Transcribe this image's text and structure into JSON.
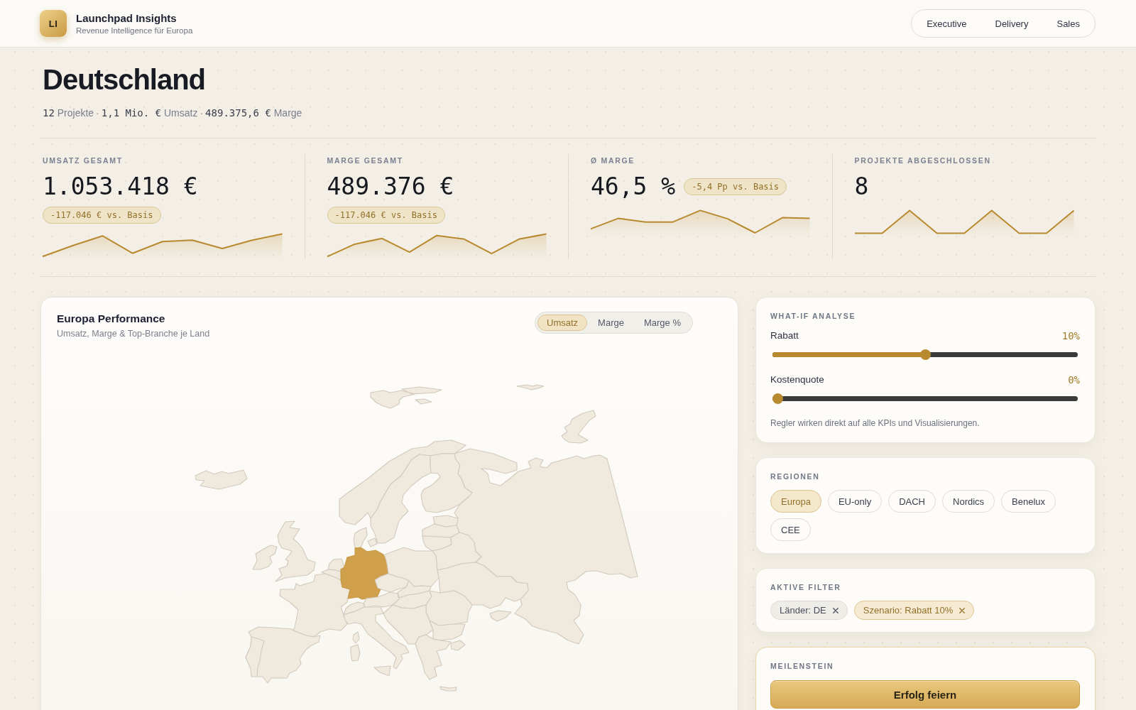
{
  "header": {
    "logo": "LI",
    "title": "Launchpad Insights",
    "subtitle": "Revenue Intelligence für Europa",
    "nav": [
      {
        "label": "Executive",
        "selected": false
      },
      {
        "label": "Delivery",
        "selected": false
      },
      {
        "label": "Sales",
        "selected": false
      }
    ]
  },
  "page": {
    "title": "Deutschland",
    "summary": [
      {
        "amount": "12",
        "metric": "Projekte"
      },
      {
        "separator": "·",
        "amount": "1,1 Mio. €",
        "metric": "Umsatz"
      },
      {
        "separator": "·",
        "amount": "489.375,6 €",
        "metric": "Marge"
      }
    ]
  },
  "kpis": [
    {
      "label": "UMSATZ GESAMT",
      "value": "1.053.418 €",
      "badge": "-117.046 € vs. Basis"
    },
    {
      "label": "MARGE GESAMT",
      "value": "489.376 €",
      "badge": "-117.046 € vs. Basis"
    },
    {
      "label": "Ø MARGE",
      "value": "46,5 %",
      "badge": "-5,4 Pp vs. Basis"
    },
    {
      "label": "PROJEKTE ABGESCHLOSSEN",
      "value": "8"
    }
  ],
  "map_panel": {
    "title": "Europa Performance",
    "subtitle": "Umsatz, Marge & Top-Branche je Land",
    "metrics": [
      {
        "label": "Umsatz",
        "selected": true
      },
      {
        "label": "Marge",
        "selected": false
      },
      {
        "label": "Marge %",
        "selected": false
      }
    ],
    "countries": [
      {
        "kind": "iceland",
        "selected": false
      },
      {
        "kind": "svalbard",
        "selected": false
      },
      {
        "kind": "franzjosef",
        "selected": false
      },
      {
        "kind": "novayazemlya",
        "selected": false
      },
      {
        "kind": "norway",
        "selected": false
      },
      {
        "kind": "sweden",
        "selected": false
      },
      {
        "kind": "finland",
        "selected": false
      },
      {
        "kind": "russia",
        "selected": false
      },
      {
        "kind": "estonia",
        "selected": false
      },
      {
        "kind": "latvia",
        "selected": false
      },
      {
        "kind": "lithuania",
        "selected": false
      },
      {
        "kind": "belarus",
        "selected": false
      },
      {
        "kind": "ukraine",
        "selected": false
      },
      {
        "kind": "uk",
        "selected": false
      },
      {
        "kind": "ireland",
        "selected": false
      },
      {
        "kind": "denmark",
        "selected": false
      },
      {
        "kind": "zealand",
        "selected": false
      },
      {
        "kind": "netherlands",
        "selected": false
      },
      {
        "kind": "belgium",
        "selected": false
      },
      {
        "kind": "france",
        "selected": false
      },
      {
        "kind": "spain",
        "selected": false
      },
      {
        "kind": "portugal",
        "selected": false
      },
      {
        "kind": "germany",
        "selected": true
      },
      {
        "kind": "poland",
        "selected": false
      },
      {
        "kind": "czechia",
        "selected": false
      },
      {
        "kind": "slovakia",
        "selected": false
      },
      {
        "kind": "austria",
        "selected": false
      },
      {
        "kind": "switzerland",
        "selected": false
      },
      {
        "kind": "hungary",
        "selected": false
      },
      {
        "kind": "romania",
        "selected": false
      },
      {
        "kind": "italy",
        "selected": false
      },
      {
        "kind": "corsica",
        "selected": false
      },
      {
        "kind": "sardinia",
        "selected": false
      },
      {
        "kind": "sicily",
        "selected": false
      },
      {
        "kind": "balkans",
        "selected": false
      },
      {
        "kind": "bulgaria",
        "selected": false
      },
      {
        "kind": "greece",
        "selected": false
      },
      {
        "kind": "turkey",
        "selected": false
      },
      {
        "kind": "crete",
        "selected": false
      }
    ]
  },
  "what_if": {
    "title": "WHAT-IF ANALYSE",
    "sliders": [
      {
        "label": "Rabatt",
        "reading": "10%",
        "level": 0.5
      },
      {
        "label": "Kostenquote",
        "reading": "0%",
        "level": 0
      }
    ],
    "note": "Regler wirken direkt auf alle KPIs und Visualisierungen."
  },
  "regions": {
    "title": "REGIONEN",
    "chips": [
      {
        "label": "Europa",
        "selected": true
      },
      {
        "label": "EU-only",
        "selected": false
      },
      {
        "label": "DACH",
        "selected": false
      },
      {
        "label": "Nordics",
        "selected": false
      },
      {
        "label": "Benelux",
        "selected": false
      },
      {
        "label": "CEE",
        "selected": false
      }
    ]
  },
  "active_filters": {
    "title": "AKTIVE FILTER",
    "filters": [
      {
        "label": "Länder: DE",
        "kind": "country"
      },
      {
        "label": "Szenario: Rabatt 10%",
        "kind": "scenario"
      }
    ]
  },
  "milestone": {
    "title": "MEILENSTEIN",
    "button": "Erfolg feiern"
  }
}
